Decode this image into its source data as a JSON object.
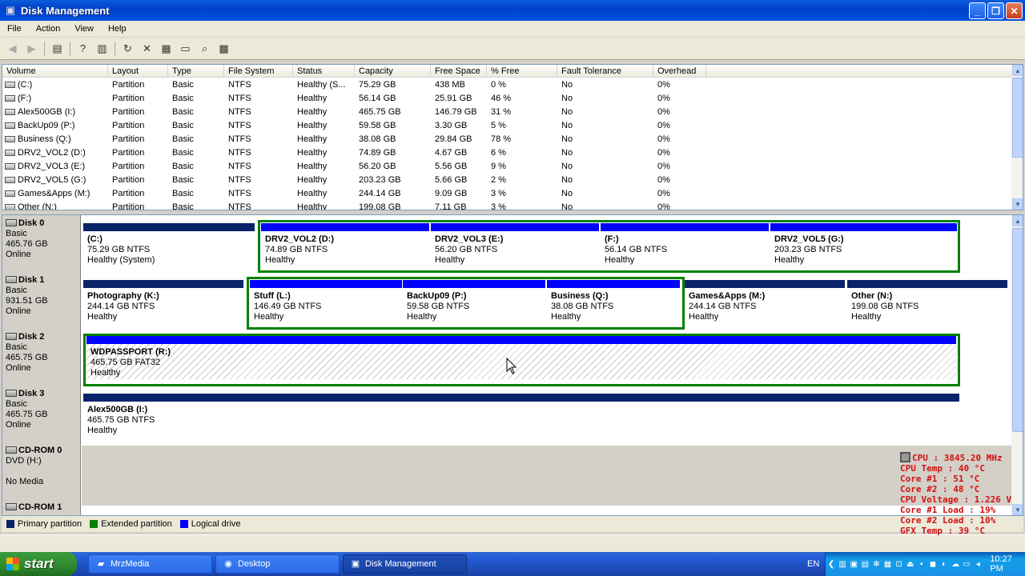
{
  "window": {
    "title": "Disk Management"
  },
  "menu": [
    "File",
    "Action",
    "View",
    "Help"
  ],
  "toolbar_icons": [
    "back-arrow-icon",
    "forward-arrow-icon",
    "show-hide-console-tree-icon",
    "help-icon",
    "properties-icon",
    "refresh-icon",
    "delete-icon",
    "properties2-icon",
    "open-icon",
    "rescan-icon",
    "options-icon"
  ],
  "columns": [
    "Volume",
    "Layout",
    "Type",
    "File System",
    "Status",
    "Capacity",
    "Free Space",
    "% Free",
    "Fault Tolerance",
    "Overhead"
  ],
  "rows": [
    [
      "(C:)",
      "Partition",
      "Basic",
      "NTFS",
      "Healthy (S...",
      "75.29 GB",
      "438 MB",
      "0 %",
      "No",
      "0%"
    ],
    [
      "(F:)",
      "Partition",
      "Basic",
      "NTFS",
      "Healthy",
      "56.14 GB",
      "25.91 GB",
      "46 %",
      "No",
      "0%"
    ],
    [
      "Alex500GB (I:)",
      "Partition",
      "Basic",
      "NTFS",
      "Healthy",
      "465.75 GB",
      "146.79 GB",
      "31 %",
      "No",
      "0%"
    ],
    [
      "BackUp09 (P:)",
      "Partition",
      "Basic",
      "NTFS",
      "Healthy",
      "59.58 GB",
      "3.30 GB",
      "5 %",
      "No",
      "0%"
    ],
    [
      "Business (Q:)",
      "Partition",
      "Basic",
      "NTFS",
      "Healthy",
      "38.08 GB",
      "29.84 GB",
      "78 %",
      "No",
      "0%"
    ],
    [
      "DRV2_VOL2 (D:)",
      "Partition",
      "Basic",
      "NTFS",
      "Healthy",
      "74.89 GB",
      "4.67 GB",
      "6 %",
      "No",
      "0%"
    ],
    [
      "DRV2_VOL3 (E:)",
      "Partition",
      "Basic",
      "NTFS",
      "Healthy",
      "56.20 GB",
      "5.56 GB",
      "9 %",
      "No",
      "0%"
    ],
    [
      "DRV2_VOL5 (G:)",
      "Partition",
      "Basic",
      "NTFS",
      "Healthy",
      "203.23 GB",
      "5.66 GB",
      "2 %",
      "No",
      "0%"
    ],
    [
      "Games&Apps (M:)",
      "Partition",
      "Basic",
      "NTFS",
      "Healthy",
      "244.14 GB",
      "9.09 GB",
      "3 %",
      "No",
      "0%"
    ],
    [
      "Other (N:)",
      "Partition",
      "Basic",
      "NTFS",
      "Healthy",
      "199.08 GB",
      "7.11 GB",
      "3 %",
      "No",
      "0%"
    ]
  ],
  "disks": [
    {
      "name": "Disk 0",
      "type": "Basic",
      "size": "465.76 GB",
      "state": "Online",
      "parts": [
        {
          "name": "(C:)",
          "size": "75.29 GB NTFS",
          "status": "Healthy (System)"
        },
        {
          "name": "DRV2_VOL2  (D:)",
          "size": "74.89 GB NTFS",
          "status": "Healthy"
        },
        {
          "name": "DRV2_VOL3  (E:)",
          "size": "56.20 GB NTFS",
          "status": "Healthy"
        },
        {
          "name": "(F:)",
          "size": "56.14 GB NTFS",
          "status": "Healthy"
        },
        {
          "name": "DRV2_VOL5  (G:)",
          "size": "203.23 GB NTFS",
          "status": "Healthy"
        }
      ]
    },
    {
      "name": "Disk 1",
      "type": "Basic",
      "size": "931.51 GB",
      "state": "Online",
      "parts": [
        {
          "name": "Photography  (K:)",
          "size": "244.14 GB NTFS",
          "status": "Healthy"
        },
        {
          "name": "Stuff  (L:)",
          "size": "146.49 GB NTFS",
          "status": "Healthy"
        },
        {
          "name": "BackUp09  (P:)",
          "size": "59.58 GB NTFS",
          "status": "Healthy"
        },
        {
          "name": "Business  (Q:)",
          "size": "38.08 GB NTFS",
          "status": "Healthy"
        },
        {
          "name": "Games&Apps  (M:)",
          "size": "244.14 GB NTFS",
          "status": "Healthy"
        },
        {
          "name": "Other  (N:)",
          "size": "199.08 GB NTFS",
          "status": "Healthy"
        }
      ]
    },
    {
      "name": "Disk 2",
      "type": "Basic",
      "size": "465.75 GB",
      "state": "Online",
      "parts": [
        {
          "name": "WDPASSPORT  (R:)",
          "size": "465.75 GB FAT32",
          "status": "Healthy"
        }
      ]
    },
    {
      "name": "Disk 3",
      "type": "Basic",
      "size": "465.75 GB",
      "state": "Online",
      "parts": [
        {
          "name": "Alex500GB  (I:)",
          "size": "465.75 GB NTFS",
          "status": "Healthy"
        }
      ]
    },
    {
      "name": "CD-ROM 0",
      "type": "DVD (H:)",
      "size": "",
      "state": "No Media",
      "parts": []
    },
    {
      "name": "CD-ROM 1",
      "type": "",
      "size": "",
      "state": "",
      "parts": []
    }
  ],
  "legend": [
    {
      "label": "Primary partition",
      "color": "#0a246a"
    },
    {
      "label": "Extended partition",
      "color": "#008000"
    },
    {
      "label": "Logical drive",
      "color": "#0000ff"
    }
  ],
  "osd": [
    "CPU : 3845.20 MHz",
    "CPU Temp : 40 °C",
    "Core #1 : 51 °C",
    "Core #2 : 48 °C",
    "CPU Voltage : 1.226 V",
    "Core #1 Load : 19%",
    "Core #2 Load : 10%",
    "GFX Temp : 39 °C"
  ],
  "taskbar": {
    "start": "start",
    "tasks": [
      "MrzMedia",
      "Desktop",
      "Disk Management"
    ],
    "lang": "EN",
    "clock": "10:27 PM"
  }
}
